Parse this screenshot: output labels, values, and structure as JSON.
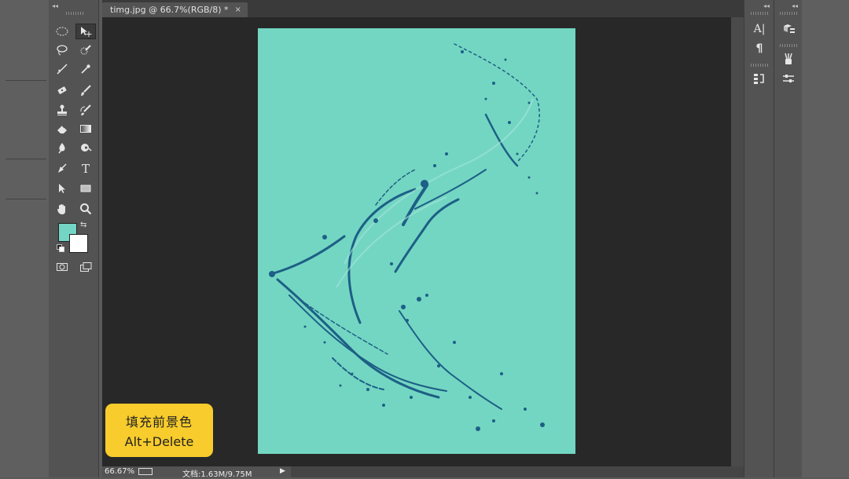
{
  "document": {
    "tab_title": "timg.jpg @ 66.7%(RGB/8) *",
    "close_glyph": "×"
  },
  "statusbar": {
    "zoom": "66.67%",
    "doc_info": "文档:1.63M/9.75M",
    "arrow": "▶"
  },
  "colors": {
    "foreground": "#74d5c4",
    "background": "#ffffff",
    "canvas_fill": "#73d6c2",
    "splash": "#1d5f86"
  },
  "tools": [
    "elliptical-marquee-icon",
    "move-icon",
    "lasso-icon",
    "quick-selection-icon",
    "crop-icon",
    "eyedropper-icon",
    "spot-healing-icon",
    "brush-icon",
    "clone-stamp-icon",
    "history-brush-icon",
    "eraser-icon",
    "gradient-icon",
    "blur-icon",
    "dodge-icon",
    "pen-icon",
    "type-icon",
    "path-selection-icon",
    "rectangle-icon",
    "hand-icon",
    "zoom-icon"
  ],
  "toolbox": {
    "type_tool_glyph": "T",
    "collapse_glyph": "◂◂"
  },
  "panels": {
    "collapse_glyph": "◂◂",
    "character_glyph": "A|",
    "paragraph_glyph": "¶"
  },
  "hint": {
    "title": "填充前景色",
    "shortcut": "Alt+Delete"
  }
}
